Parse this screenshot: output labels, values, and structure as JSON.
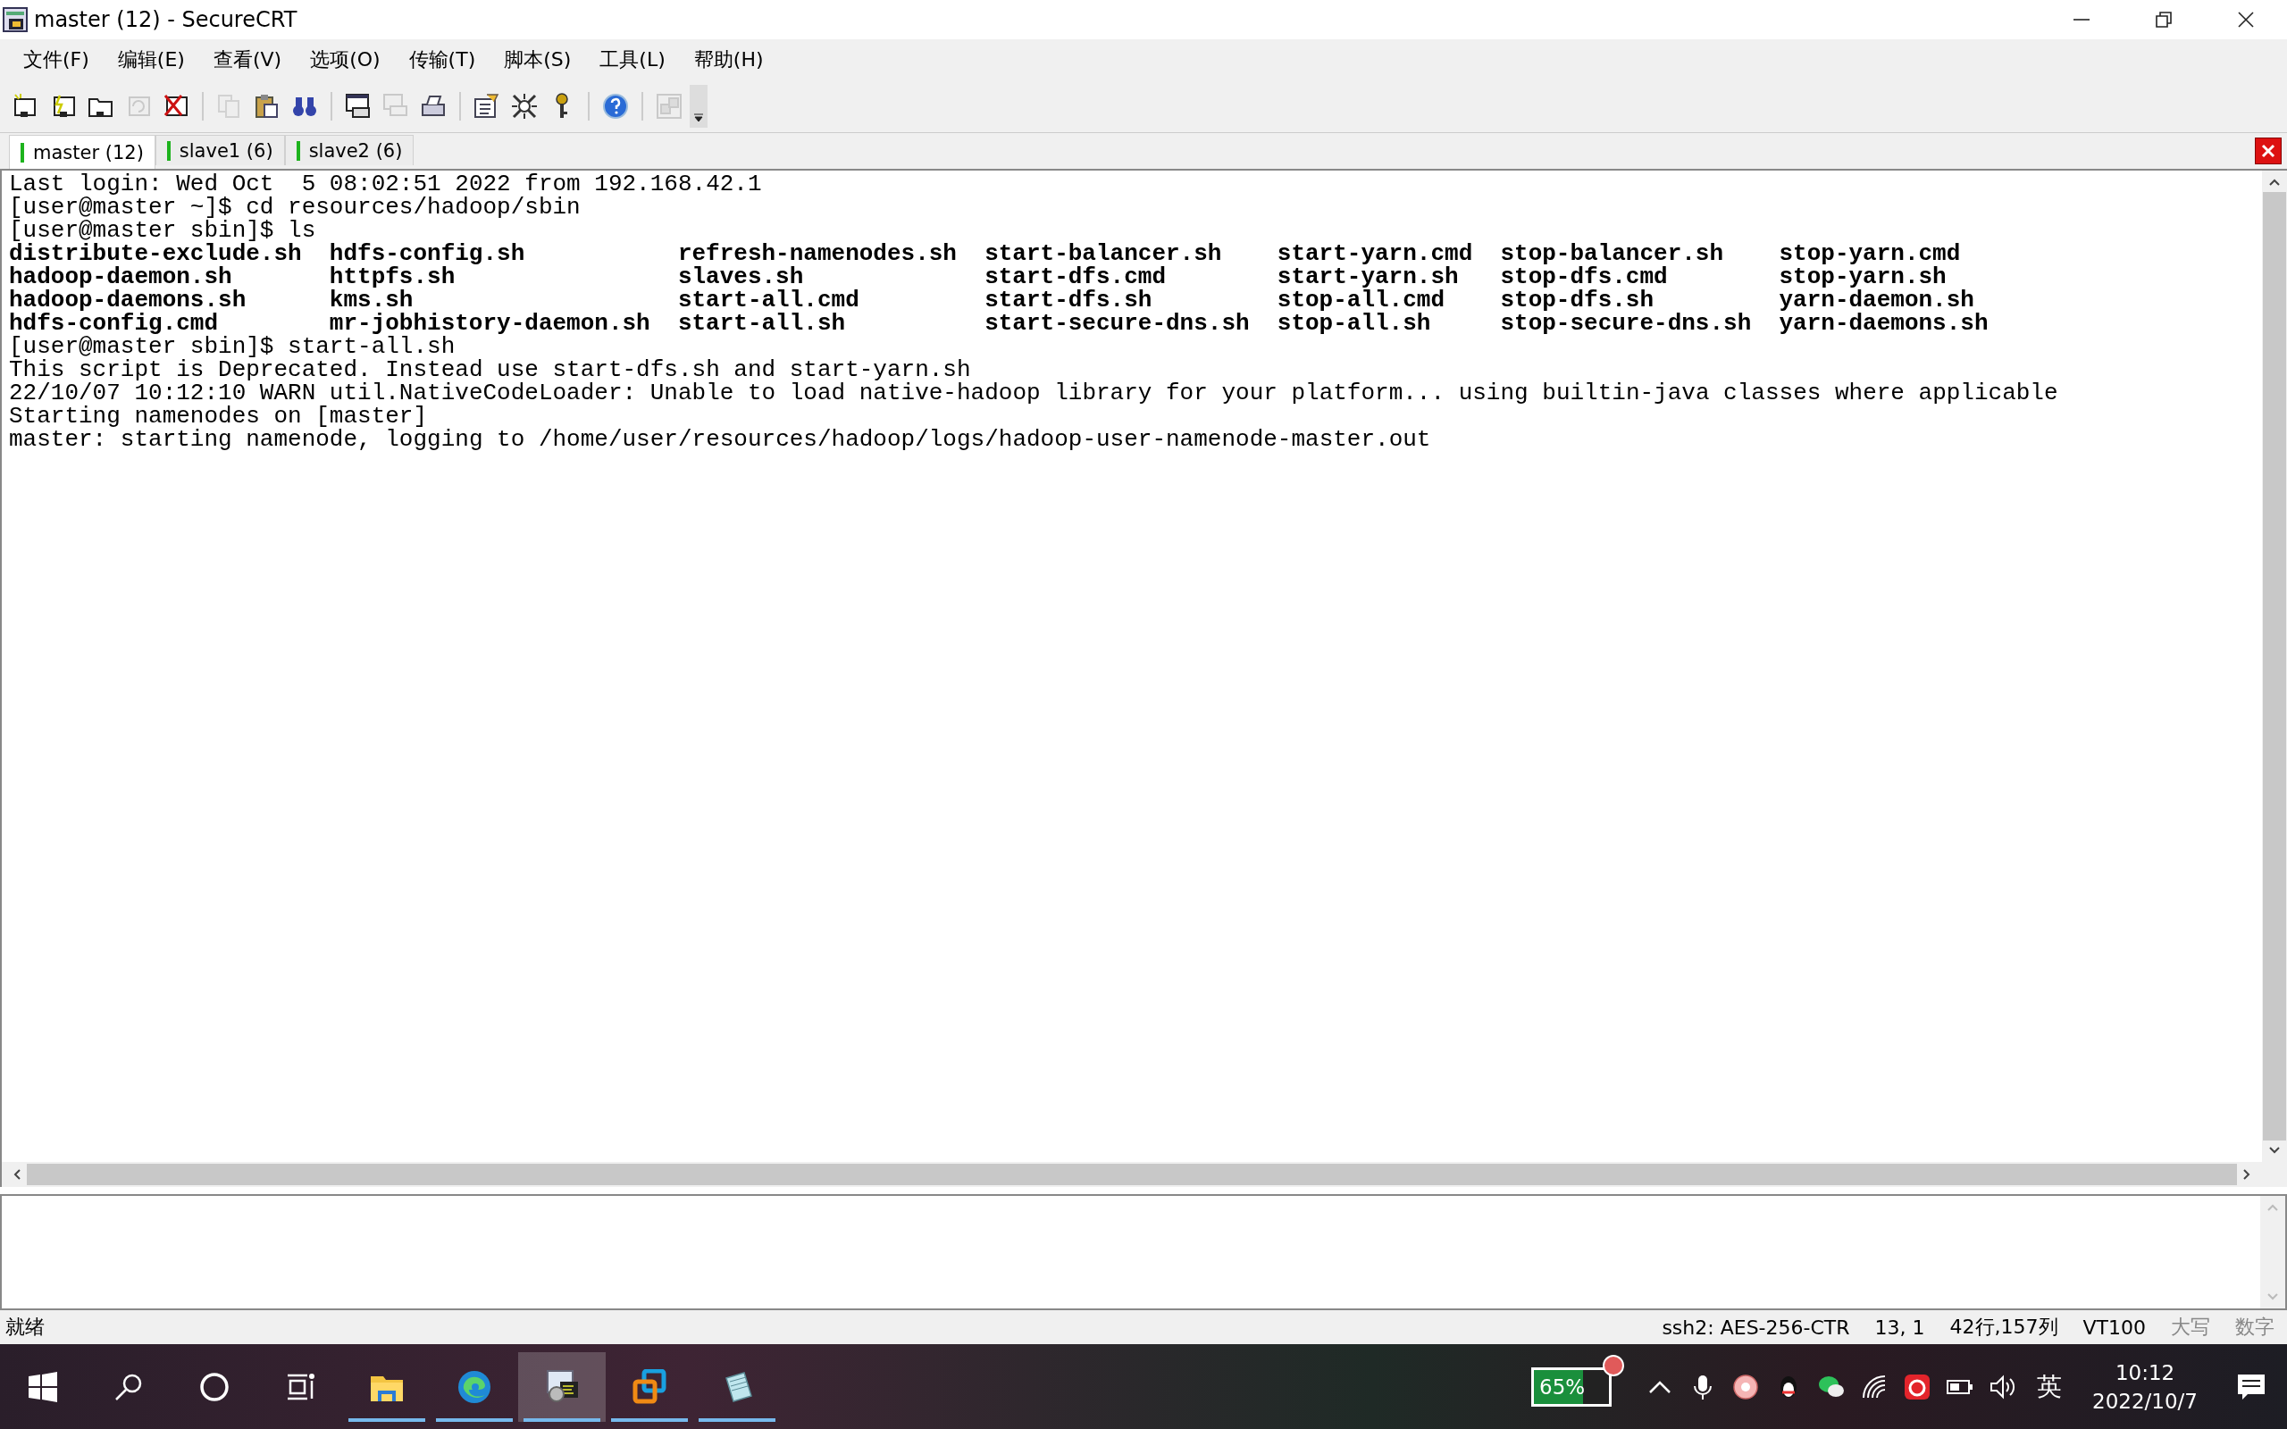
{
  "window": {
    "title": "master (12) - SecureCRT"
  },
  "menu": [
    {
      "label": "文件(F)"
    },
    {
      "label": "编辑(E)"
    },
    {
      "label": "查看(V)"
    },
    {
      "label": "选项(O)"
    },
    {
      "label": "传输(T)"
    },
    {
      "label": "脚本(S)"
    },
    {
      "label": "工具(L)"
    },
    {
      "label": "帮助(H)"
    }
  ],
  "toolbar": {
    "groups": [
      [
        {
          "disabled": false
        },
        {
          "disabled": false
        },
        {
          "disabled": false
        },
        {
          "disabled": true
        },
        {
          "disabled": false
        }
      ],
      [
        {
          "disabled": true
        },
        {
          "disabled": false
        },
        {
          "disabled": false
        }
      ],
      [
        {
          "disabled": false
        },
        {
          "disabled": true
        },
        {
          "disabled": false
        }
      ],
      [
        {
          "disabled": false
        },
        {
          "disabled": false
        },
        {
          "disabled": false
        }
      ],
      [
        {
          "disabled": false
        }
      ],
      [
        {
          "disabled": true
        }
      ]
    ]
  },
  "tabs": [
    {
      "label": "master (12)",
      "selected": true,
      "connected": true
    },
    {
      "label": "slave1 (6)",
      "selected": false,
      "connected": true
    },
    {
      "label": "slave2 (6)",
      "selected": false,
      "connected": true
    }
  ],
  "terminal": {
    "lines": [
      {
        "kind": "text",
        "text": "Last login: Wed Oct  5 08:02:51 2022 from 192.168.42.1"
      },
      {
        "kind": "text",
        "text": "[user@master ~]$ cd resources/hadoop/sbin"
      },
      {
        "kind": "text",
        "text": "[user@master sbin]$ ls"
      },
      {
        "kind": "files",
        "cells": [
          "distribute-exclude.sh",
          "hdfs-config.sh",
          "refresh-namenodes.sh",
          "start-balancer.sh",
          "start-yarn.cmd",
          "stop-balancer.sh",
          "stop-yarn.cmd"
        ]
      },
      {
        "kind": "files",
        "cells": [
          "hadoop-daemon.sh",
          "httpfs.sh",
          "slaves.sh",
          "start-dfs.cmd",
          "start-yarn.sh",
          "stop-dfs.cmd",
          "stop-yarn.sh"
        ]
      },
      {
        "kind": "files",
        "cells": [
          "hadoop-daemons.sh",
          "kms.sh",
          "start-all.cmd",
          "start-dfs.sh",
          "stop-all.cmd",
          "stop-dfs.sh",
          "yarn-daemon.sh"
        ]
      },
      {
        "kind": "files",
        "cells": [
          "hdfs-config.cmd",
          "mr-jobhistory-daemon.sh",
          "start-all.sh",
          "start-secure-dns.sh",
          "stop-all.sh",
          "stop-secure-dns.sh",
          "yarn-daemons.sh"
        ]
      },
      {
        "kind": "text",
        "text": "[user@master sbin]$ start-all.sh"
      },
      {
        "kind": "text",
        "text": "This script is Deprecated. Instead use start-dfs.sh and start-yarn.sh"
      },
      {
        "kind": "text",
        "text": "22/10/07 10:12:10 WARN util.NativeCodeLoader: Unable to load native-hadoop library for your platform... using builtin-java classes where applicable"
      },
      {
        "kind": "text",
        "text": "Starting namenodes on [master]"
      },
      {
        "kind": "text",
        "text": "master: starting namenode, logging to /home/user/resources/hadoop/logs/hadoop-user-namenode-master.out"
      }
    ]
  },
  "status_bar": {
    "text": "就绪",
    "panels": [
      {
        "text": "ssh2: AES-256-CTR",
        "disabled": false
      },
      {
        "text": "13,    1",
        "disabled": false
      },
      {
        "text": "42行,157列",
        "disabled": false
      },
      {
        "text": "VT100",
        "disabled": false
      },
      {
        "text": "大写",
        "disabled": true
      },
      {
        "text": "数字",
        "disabled": true
      }
    ]
  },
  "taskbar": {
    "apps": [
      {
        "running": true,
        "selected": false
      },
      {
        "running": true,
        "selected": false
      },
      {
        "running": true,
        "selected": true
      },
      {
        "running": true,
        "selected": false
      },
      {
        "running": true,
        "selected": false
      }
    ],
    "battery": {
      "text": "65%",
      "level": 0.65
    },
    "ime": "英",
    "time": "10:12",
    "date": "2022/10/7"
  }
}
